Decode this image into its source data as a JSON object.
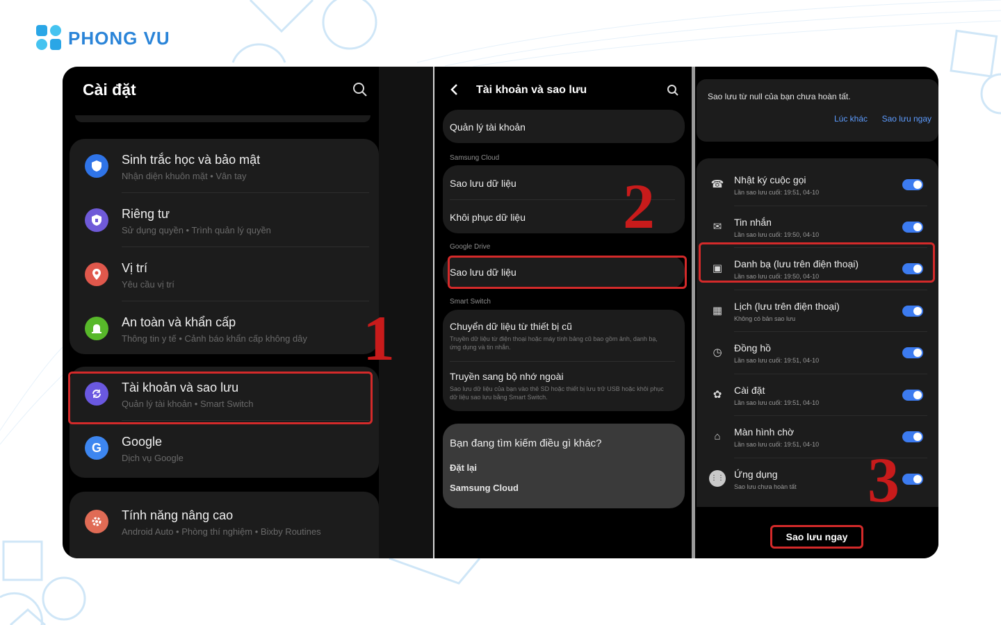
{
  "brand": {
    "name": "PHONG VU",
    "color": "#2a84d8"
  },
  "panel1": {
    "title": "Cài đặt",
    "items": [
      {
        "title": "Sinh trắc học và bảo mật",
        "subtitle": "Nhận diện khuôn mặt  •  Vân tay",
        "icon": "shield-icon",
        "color": "#2f74e8"
      },
      {
        "title": "Riêng tư",
        "subtitle": "Sử dụng quyền  •  Trình quản lý quyền",
        "icon": "privacy-shield-icon",
        "color": "#6f5ad8"
      },
      {
        "title": "Vị trí",
        "subtitle": "Yêu cầu vị trí",
        "icon": "location-pin-icon",
        "color": "#e0584c"
      },
      {
        "title": "An toàn và khẩn cấp",
        "subtitle": "Thông tin y tế  •  Cảnh báo khẩn cấp không dây",
        "icon": "emergency-icon",
        "color": "#58b82a"
      },
      {
        "title": "Tài khoản và sao lưu",
        "subtitle": "Quản lý tài khoản  •  Smart Switch",
        "icon": "sync-icon",
        "color": "#6a58e0"
      },
      {
        "title": "Google",
        "subtitle": "Dịch vụ Google",
        "icon": "google-icon",
        "color": "#3d86f0"
      },
      {
        "title": "Tính năng nâng cao",
        "subtitle": "Android Auto  •  Phòng thí nghiệm  •  Bixby Routines",
        "icon": "gear-icon",
        "color": "#e06b55"
      }
    ],
    "step": "1"
  },
  "panel2": {
    "title": "Tài khoản và sao lưu",
    "manage": "Quản lý tài khoản",
    "sections": {
      "samsung_cloud": "Samsung Cloud",
      "google_drive": "Google Drive",
      "smart_switch": "Smart Switch"
    },
    "backup": "Sao lưu dữ liệu",
    "restore": "Khôi phục dữ liệu",
    "gdrive_backup": "Sao lưu dữ liệu",
    "transfer_title": "Chuyển dữ liệu từ thiết bị cũ",
    "transfer_desc": "Truyền dữ liệu từ điện thoại hoặc máy tính bảng cũ bao gồm ảnh, danh bạ, ứng dụng và tin nhắn.",
    "external_title": "Truyền sang bộ nhớ ngoài",
    "external_desc": "Sao lưu dữ liệu của bạn vào thẻ SD hoặc thiết bị lưu trữ USB hoặc khôi phục dữ liệu sao lưu bằng Smart Switch.",
    "looking_title": "Bạn đang tìm kiếm điều gì khác?",
    "reset": "Đặt lại",
    "samsung_cloud_link": "Samsung Cloud",
    "step": "2"
  },
  "panel3": {
    "notice": "Sao lưu từ null của bạn chưa hoàn tất.",
    "later": "Lúc khác",
    "backup_now_link": "Sao lưu ngay",
    "items": [
      {
        "title": "Nhật ký cuộc gọi",
        "sub": "Lần sao lưu cuối: 19:51, 04-10",
        "icon": "phone-icon",
        "glyph": "☎",
        "on": true
      },
      {
        "title": "Tin nhắn",
        "sub": "Lần sao lưu cuối: 19:50, 04-10",
        "icon": "message-icon",
        "glyph": "✉",
        "on": true
      },
      {
        "title": "Danh bạ (lưu trên điện thoại)",
        "sub": "Lần sao lưu cuối: 19:50, 04-10",
        "icon": "contacts-icon",
        "glyph": "▣",
        "on": true
      },
      {
        "title": "Lịch (lưu trên điện thoại)",
        "sub": "Không có bản sao lưu",
        "icon": "calendar-icon",
        "glyph": "▦",
        "on": true
      },
      {
        "title": "Đồng hồ",
        "sub": "Lần sao lưu cuối: 19:51, 04-10",
        "icon": "clock-icon",
        "glyph": "◷",
        "on": true
      },
      {
        "title": "Cài đặt",
        "sub": "Lần sao lưu cuối: 19:51, 04-10",
        "icon": "settings-icon",
        "glyph": "✿",
        "on": true
      },
      {
        "title": "Màn hình chờ",
        "sub": "Lần sao lưu cuối: 19:51, 04-10",
        "icon": "home-screen-icon",
        "glyph": "⌂",
        "on": true
      },
      {
        "title": "Ứng dụng",
        "sub": "Sao lưu chưa hoàn tất",
        "icon": "apps-icon",
        "glyph": "⋮⋮",
        "on": true
      }
    ],
    "button": "Sao lưu ngay",
    "step": "3"
  }
}
